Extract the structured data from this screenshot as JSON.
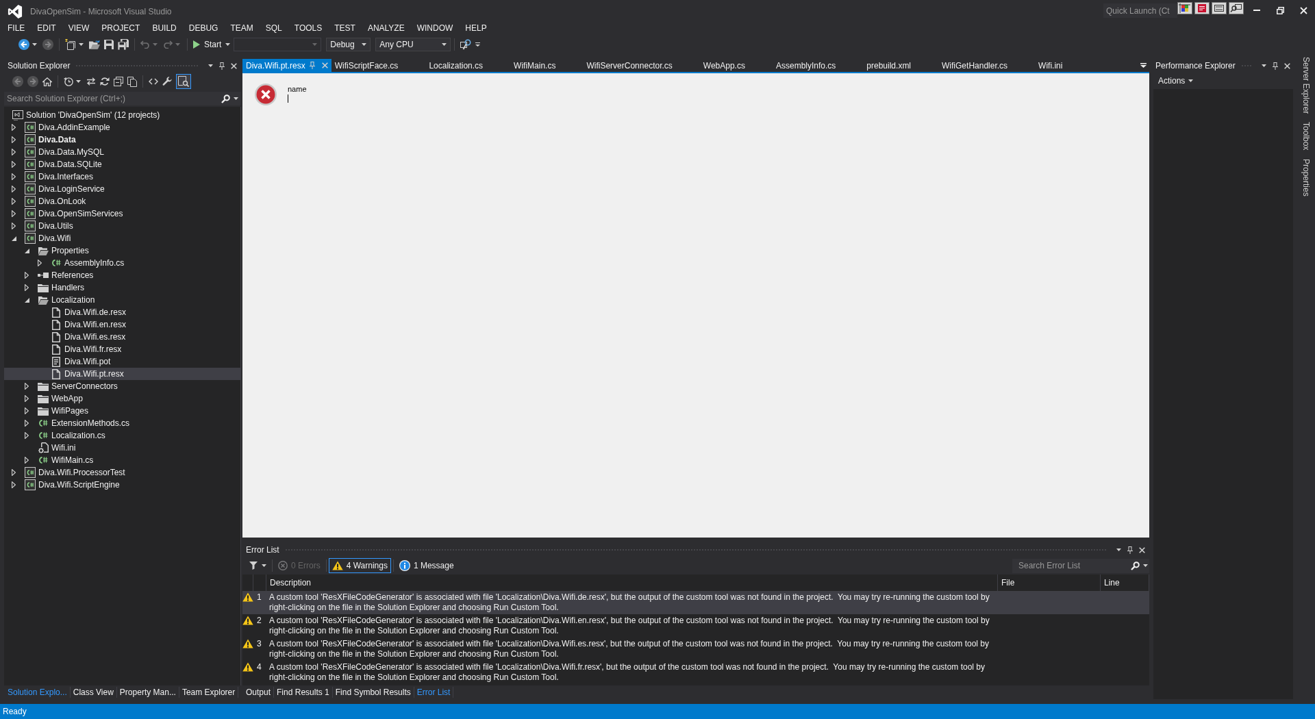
{
  "window": {
    "title": "DivaOpenSim - Microsoft Visual Studio",
    "quick_launch": {
      "placeholder": "Quick Launch (Ct"
    }
  },
  "menu": [
    "FILE",
    "EDIT",
    "VIEW",
    "PROJECT",
    "BUILD",
    "DEBUG",
    "TEAM",
    "SQL",
    "TOOLS",
    "TEST",
    "ANALYZE",
    "WINDOW",
    "HELP"
  ],
  "toolbar": {
    "groups": [
      [
        {
          "kind": "back",
          "disabled": false
        },
        {
          "kind": "forward",
          "disabled": true
        }
      ],
      [
        {
          "kind": "new",
          "disabled": false
        },
        {
          "kind": "open",
          "disabled": false
        },
        {
          "kind": "save",
          "disabled": false
        },
        {
          "kind": "saveall",
          "disabled": false
        }
      ],
      [
        {
          "kind": "undo",
          "disabled": true
        },
        {
          "kind": "redo",
          "disabled": true
        }
      ]
    ],
    "start": {
      "label": "Start"
    },
    "combos": [
      {
        "disabled": true
      },
      {
        "value": "Debug",
        "disabled": false
      },
      {
        "value": "Any CPU",
        "disabled": false
      }
    ]
  },
  "solution_explorer": {
    "title": "Solution Explorer",
    "toolbar": [
      [
        {
          "kind": "back",
          "disabled": true,
          "on": false
        },
        {
          "kind": "forward",
          "disabled": true,
          "on": false
        },
        {
          "kind": "home",
          "disabled": false,
          "on": false
        }
      ],
      [
        {
          "kind": "history",
          "disabled": false,
          "on": false
        },
        {
          "kind": "sync",
          "disabled": false,
          "on": false
        },
        {
          "kind": "refresh",
          "disabled": false,
          "on": false
        },
        {
          "kind": "collapse",
          "disabled": false,
          "on": false
        },
        {
          "kind": "showall",
          "disabled": false,
          "on": false
        }
      ],
      [
        {
          "kind": "code",
          "disabled": false,
          "on": false
        },
        {
          "kind": "properties",
          "disabled": false,
          "on": false
        },
        {
          "kind": "preview",
          "disabled": false,
          "on": true
        }
      ]
    ],
    "search": {
      "placeholder": "Search Solution Explorer (Ctrl+;)"
    },
    "tree": [
      {
        "label": "Solution 'DivaOpenSim' (12 projects)",
        "kind": "solution",
        "selected": false,
        "children": [
          {
            "label": "Diva.AddinExample",
            "kind": "project",
            "startup": false,
            "expanded": false,
            "selected": false
          },
          {
            "label": "Diva.Data",
            "kind": "project",
            "startup": true,
            "expanded": false,
            "selected": false
          },
          {
            "label": "Diva.Data.MySQL",
            "kind": "project",
            "startup": false,
            "expanded": false,
            "selected": false
          },
          {
            "label": "Diva.Data.SQLite",
            "kind": "project",
            "startup": false,
            "expanded": false,
            "selected": false
          },
          {
            "label": "Diva.Interfaces",
            "kind": "project",
            "startup": false,
            "expanded": false,
            "selected": false
          },
          {
            "label": "Diva.LoginService",
            "kind": "project",
            "startup": false,
            "expanded": false,
            "selected": false
          },
          {
            "label": "Diva.OnLook",
            "kind": "project",
            "startup": false,
            "expanded": false,
            "selected": false
          },
          {
            "label": "Diva.OpenSimServices",
            "kind": "project",
            "startup": false,
            "expanded": false,
            "selected": false
          },
          {
            "label": "Diva.Utils",
            "kind": "project",
            "startup": false,
            "expanded": false,
            "selected": false
          },
          {
            "label": "Diva.Wifi",
            "kind": "project",
            "startup": false,
            "expanded": true,
            "selected": false,
            "children": [
              {
                "label": "Properties",
                "kind": "folder",
                "expanded": true,
                "selected": false,
                "children": [
                  {
                    "label": "AssemblyInfo.cs",
                    "kind": "csharp",
                    "expanded": false,
                    "selected": false
                  }
                ]
              },
              {
                "label": "References",
                "kind": "references",
                "expanded": false,
                "selected": false
              },
              {
                "label": "Handlers",
                "kind": "folder",
                "expanded": false,
                "selected": false
              },
              {
                "label": "Localization",
                "kind": "folder",
                "expanded": true,
                "selected": false,
                "children": [
                  {
                    "label": "Diva.Wifi.de.resx",
                    "kind": "resource",
                    "selected": false
                  },
                  {
                    "label": "Diva.Wifi.en.resx",
                    "kind": "resource",
                    "selected": false
                  },
                  {
                    "label": "Diva.Wifi.es.resx",
                    "kind": "resource",
                    "selected": false
                  },
                  {
                    "label": "Diva.Wifi.fr.resx",
                    "kind": "resource",
                    "selected": false
                  },
                  {
                    "label": "Diva.Wifi.pot",
                    "kind": "pot",
                    "selected": false
                  },
                  {
                    "label": "Diva.Wifi.pt.resx",
                    "kind": "resource",
                    "selected": true
                  }
                ]
              },
              {
                "label": "ServerConnectors",
                "kind": "folder",
                "expanded": false,
                "selected": false
              },
              {
                "label": "WebApp",
                "kind": "folder",
                "expanded": false,
                "selected": false
              },
              {
                "label": "WifiPages",
                "kind": "folder",
                "expanded": false,
                "selected": false
              },
              {
                "label": "ExtensionMethods.cs",
                "kind": "csharp",
                "expanded": false,
                "selected": false
              },
              {
                "label": "Localization.cs",
                "kind": "csharp",
                "expanded": false,
                "selected": false
              },
              {
                "label": "Wifi.ini",
                "kind": "settings",
                "selected": false
              },
              {
                "label": "WifiMain.cs",
                "kind": "csharp",
                "expanded": false,
                "selected": false
              }
            ]
          },
          {
            "label": "Diva.Wifi.ProcessorTest",
            "kind": "project",
            "startup": false,
            "expanded": false,
            "selected": false
          },
          {
            "label": "Diva.Wifi.ScriptEngine",
            "kind": "project",
            "startup": false,
            "expanded": false,
            "selected": false
          }
        ]
      }
    ]
  },
  "left_tabs": [
    {
      "label": "Solution Explo...",
      "selected": true
    },
    {
      "label": "Class View",
      "selected": false
    },
    {
      "label": "Property Man...",
      "selected": false
    },
    {
      "label": "Team Explorer",
      "selected": false
    }
  ],
  "documents": {
    "tabs": [
      {
        "label": "Diva.Wifi.pt.resx",
        "selected": true
      },
      {
        "label": "WifiScriptFace.cs",
        "selected": false
      },
      {
        "label": "Localization.cs",
        "selected": false
      },
      {
        "label": "WifiMain.cs",
        "selected": false
      },
      {
        "label": "WifiServerConnector.cs",
        "selected": false
      },
      {
        "label": "WebApp.cs",
        "selected": false
      },
      {
        "label": "AssemblyInfo.cs",
        "selected": false
      },
      {
        "label": "prebuild.xml",
        "selected": false
      },
      {
        "label": "WifiGetHandler.cs",
        "selected": false
      },
      {
        "label": "Wifi.ini",
        "selected": false
      }
    ],
    "editor": {
      "label": "name"
    }
  },
  "error_list": {
    "title": "Error List",
    "filters": [
      {
        "kind": "errors",
        "label": "0 Errors",
        "selected": false,
        "disabled": true
      },
      {
        "kind": "warnings",
        "label": "4 Warnings",
        "selected": true,
        "disabled": false
      },
      {
        "kind": "messages",
        "label": "1 Message",
        "selected": false,
        "disabled": false
      }
    ],
    "search": {
      "placeholder": "Search Error List"
    },
    "columns": [
      "Description",
      "File",
      "Line"
    ],
    "rows": [
      {
        "kind": "warning",
        "number": "1",
        "description": "A custom tool 'ResXFileCodeGenerator' is associated with file 'Localization\\Diva.Wifi.de.resx', but the output of the custom tool was not found in the project.  You may try re-running the custom tool by right-clicking on the file in the Solution Explorer and choosing Run Custom Tool.",
        "selected": true
      },
      {
        "kind": "warning",
        "number": "2",
        "description": "A custom tool 'ResXFileCodeGenerator' is associated with file 'Localization\\Diva.Wifi.en.resx', but the output of the custom tool was not found in the project.  You may try re-running the custom tool by right-clicking on the file in the Solution Explorer and choosing Run Custom Tool.",
        "selected": false
      },
      {
        "kind": "warning",
        "number": "3",
        "description": "A custom tool 'ResXFileCodeGenerator' is associated with file 'Localization\\Diva.Wifi.es.resx', but the output of the custom tool was not found in the project.  You may try re-running the custom tool by right-clicking on the file in the Solution Explorer and choosing Run Custom Tool.",
        "selected": false
      },
      {
        "kind": "warning",
        "number": "4",
        "description": "A custom tool 'ResXFileCodeGenerator' is associated with file 'Localization\\Diva.Wifi.fr.resx', but the output of the custom tool was not found in the project.  You may try re-running the custom tool by right-clicking on the file in the Solution Explorer and choosing Run Custom Tool.",
        "selected": false
      }
    ]
  },
  "output_tabs": [
    {
      "label": "Output",
      "selected": false
    },
    {
      "label": "Find Results 1",
      "selected": false
    },
    {
      "label": "Find Symbol Results",
      "selected": false
    },
    {
      "label": "Error List",
      "selected": true
    }
  ],
  "performance_explorer": {
    "title": "Performance Explorer",
    "actions": "Actions"
  },
  "side_tabs": [
    "Server Explorer",
    "Toolbox",
    "Properties"
  ],
  "status_bar": {
    "text": "Ready"
  }
}
